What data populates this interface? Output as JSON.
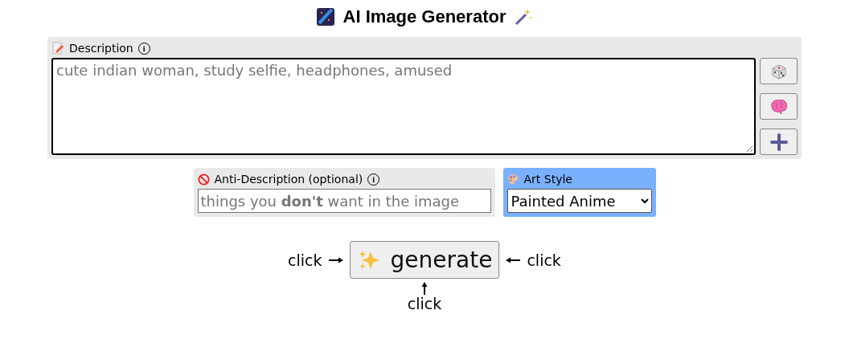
{
  "title": "AI Image Generator",
  "description": {
    "label": "Description",
    "info": "i",
    "placeholder": "cute indian woman, study selfie, headphones, amused"
  },
  "side_buttons": [
    {
      "kind": "dice"
    },
    {
      "kind": "brain"
    },
    {
      "kind": "plus"
    }
  ],
  "anti_description": {
    "label": "Anti-Description (optional)",
    "info": "i",
    "placeholder": "things you **don't** want in the image"
  },
  "art_style": {
    "label": "Art Style",
    "value": "Painted Anime"
  },
  "generate": {
    "label": "generate",
    "left_hint": "click",
    "right_hint": "click",
    "bottom_hint": "click"
  }
}
